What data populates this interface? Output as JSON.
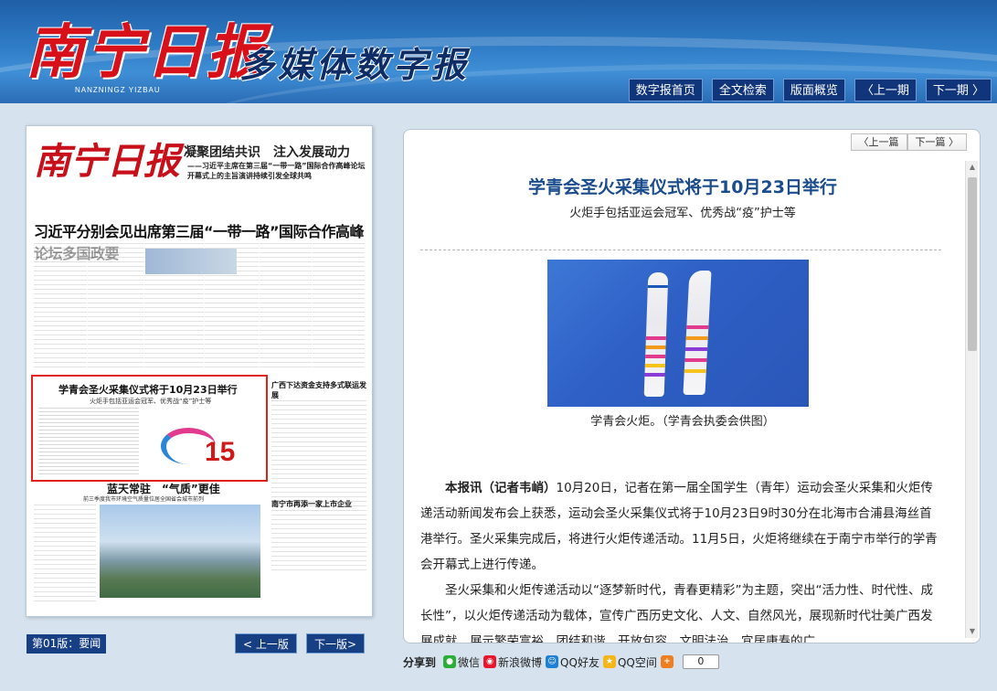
{
  "header": {
    "logo_main": "南宁日报",
    "logo_pinyin": "NANZNINGZ YIZBAU",
    "logo_sub": "多媒体数字报",
    "nav": [
      "数字报首页",
      "全文检索",
      "版面概览",
      "〈上一期",
      "下一期 〉"
    ]
  },
  "paper": {
    "masthead": "南宁日报",
    "headline_top": "凝聚团结共识　注入发展动力",
    "headline_sub": "——习近平主席在第三届“一带一路”国际合作高峰论坛开幕式上的主旨演讲持续引发全球共鸣",
    "lead_headline": "习近平分别会见出席第三届“一带一路”国际合作高峰论坛多国政要",
    "highlight_title": "学青会圣火采集仪式将于10月23日举行",
    "highlight_sub": "火炬手包括亚运会冠军、优秀战“疫”护士等",
    "highlight_count": "15",
    "side_head": "广西下达资金支持多式联运发展",
    "mid_head": "蓝天常驻　“气质”更佳",
    "mid_sub": "前三季度我市环境空气质量位居全国省会城市前列",
    "side_head2": "南宁市再添一家上市企业"
  },
  "paper_nav": {
    "edition": "第01版：要闻",
    "prev": "< 上一版",
    "next": "下一版>"
  },
  "article": {
    "pager_prev": "〈上一篇",
    "pager_next": "下一篇 〉",
    "title": "学青会圣火采集仪式将于10月23日举行",
    "subtitle": "火炬手包括亚运会冠军、优秀战“疫”护士等",
    "caption": "学青会火炬。（学青会执委会供图）",
    "lead_tag": "本报讯（记者韦峭）",
    "para1": "10月20日，记者在第一届全国学生（青年）运动会圣火采集和火炬传递活动新闻发布会上获悉，运动会圣火采集仪式将于10月23日9时30分在北海市合浦县海丝首港举行。圣火采集完成后，将进行火炬传递活动。11月5日，火炬将继续在于南宁市举行的学青会开幕式上进行传递。",
    "para2": "圣火采集和火炬传递活动以“逐梦新时代，青春更精彩”为主题，突出“活力性、时代性、成长性”，以火炬传递活动为载体，宣传广西历史文化、人文、自然风光，展现新时代壮美广西发展成就，展示繁荣富裕、团结和谐、开放包容、文明法治、宜居康寿的广"
  },
  "share": {
    "label": "分享到",
    "items": [
      "微信",
      "新浪微博",
      "QQ好友",
      "QQ空间"
    ],
    "count": "0"
  }
}
